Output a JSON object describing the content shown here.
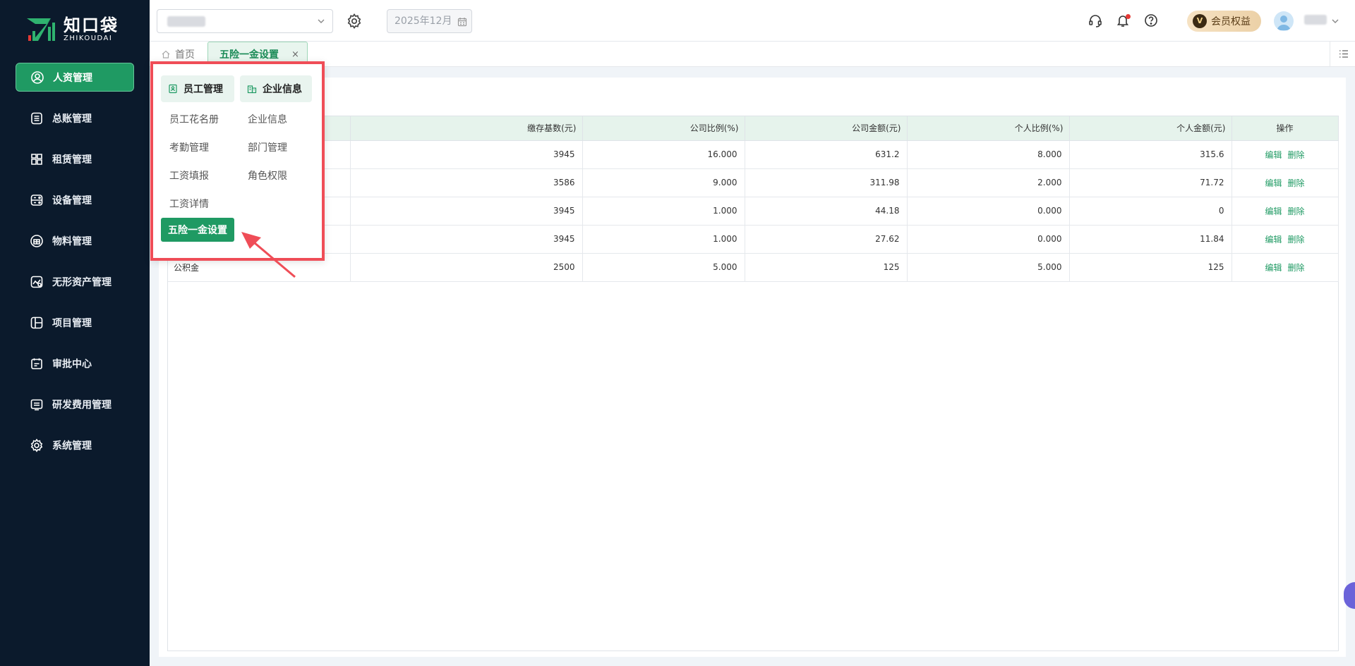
{
  "brand": {
    "name_cn": "知口袋",
    "name_en": "ZHIKOUDAI"
  },
  "sidebar": {
    "items": [
      {
        "label": "人资管理",
        "icon": "user-circle-icon",
        "active": true
      },
      {
        "label": "总账管理",
        "icon": "ledger-icon"
      },
      {
        "label": "租赁管理",
        "icon": "lease-icon"
      },
      {
        "label": "设备管理",
        "icon": "device-icon"
      },
      {
        "label": "物料管理",
        "icon": "material-icon"
      },
      {
        "label": "无形资产管理",
        "icon": "intangible-asset-icon"
      },
      {
        "label": "项目管理",
        "icon": "project-icon"
      },
      {
        "label": "审批中心",
        "icon": "approval-icon"
      },
      {
        "label": "研发费用管理",
        "icon": "rd-expense-icon"
      },
      {
        "label": "系统管理",
        "icon": "system-gear-icon"
      }
    ]
  },
  "topbar": {
    "date": "2025年12月",
    "vip_badge": "V",
    "vip_label": "会员权益"
  },
  "tabs": {
    "home": "首页",
    "active": "五险一金设置",
    "close": "×"
  },
  "popup": {
    "headers": [
      "员工管理",
      "企业信息"
    ],
    "col1": [
      "员工花名册",
      "考勤管理",
      "工资填报",
      "工资详情"
    ],
    "col2": [
      "企业信息",
      "部门管理",
      "角色权限"
    ],
    "active_item": "五险一金设置"
  },
  "table": {
    "columns": [
      "",
      "缴存基数(元)",
      "公司比例(%)",
      "公司金额(元)",
      "个人比例(%)",
      "个人金额(元)",
      "操作"
    ],
    "rows": [
      {
        "name": "",
        "base": "3945",
        "company_ratio": "16.000",
        "company_amount": "631.2",
        "personal_ratio": "8.000",
        "personal_amount": "315.6"
      },
      {
        "name": "",
        "base": "3586",
        "company_ratio": "9.000",
        "company_amount": "311.98",
        "personal_ratio": "2.000",
        "personal_amount": "71.72"
      },
      {
        "name": "",
        "base": "3945",
        "company_ratio": "1.000",
        "company_amount": "44.18",
        "personal_ratio": "0.000",
        "personal_amount": "0"
      },
      {
        "name": "",
        "base": "3945",
        "company_ratio": "1.000",
        "company_amount": "27.62",
        "personal_ratio": "0.000",
        "personal_amount": "11.84"
      },
      {
        "name": "公积金",
        "base": "2500",
        "company_ratio": "5.000",
        "company_amount": "125",
        "personal_ratio": "5.000",
        "personal_amount": "125"
      }
    ],
    "edit_label": "编辑",
    "delete_label": "删除"
  },
  "colors": {
    "accent": "#1f9a63",
    "sidebar_bg": "#0b1a2c",
    "highlight_red": "#ef4d57"
  }
}
